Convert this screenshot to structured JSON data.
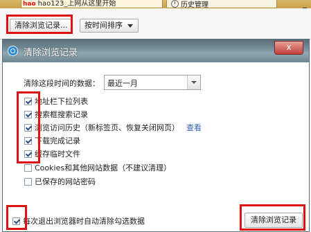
{
  "tabs": [
    {
      "logo": "hao",
      "label": "hao123_上网从这里开始"
    },
    {
      "label": "历史管理"
    }
  ],
  "window_controls": "_",
  "toolbar": {
    "clear_label": "清除浏览记录...",
    "sort_label": "按时间排序"
  },
  "dialog": {
    "title": "清除浏览记录",
    "close_label": "x",
    "range_label": "清除这段时间的数据：",
    "range_value": "最近一月",
    "options": [
      {
        "label": "地址栏下拉列表",
        "checked": true
      },
      {
        "label": "搜索框搜索记录",
        "checked": true
      },
      {
        "label": "浏览访问历史（新标签页、恢复关闭网页）",
        "checked": true,
        "link": "查看"
      },
      {
        "label": "下载完成记录",
        "checked": true
      },
      {
        "label": "缓存临时文件",
        "checked": true
      },
      {
        "label": "Cookies和其他网站数据（不建议清理）",
        "checked": false
      },
      {
        "label": "已保存的网站密码",
        "checked": false
      }
    ],
    "auto_clear_label": "每次退出浏览器时自动清除勾选数据",
    "auto_clear_checked": true,
    "clear_button_label": "清除浏览记录"
  },
  "colors": {
    "highlight": "#e01010",
    "titlebar": "#6f8a96",
    "link": "#2d5fb8"
  }
}
